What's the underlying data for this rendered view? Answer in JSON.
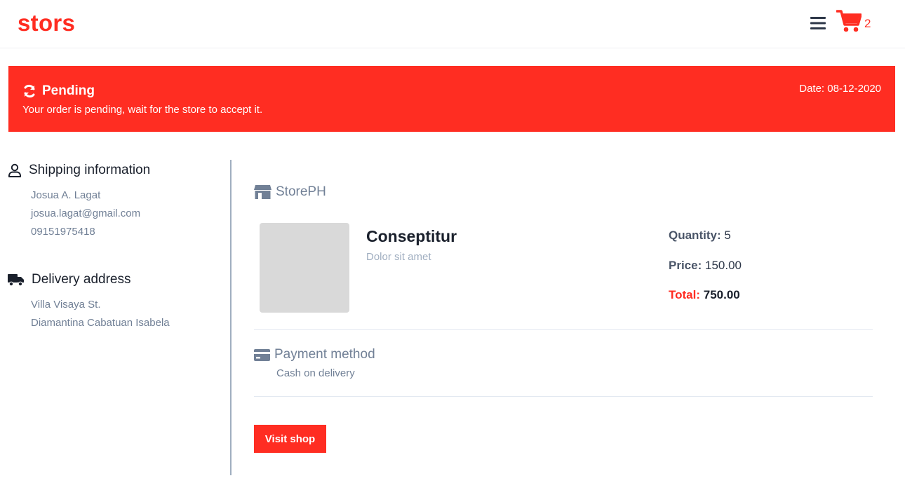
{
  "header": {
    "brand": "stors",
    "cart_count": "2",
    "accent_color": "#ff2d22",
    "icons": [
      "menu-icon",
      "cart-icon"
    ]
  },
  "banner": {
    "status": "Pending",
    "message": "Your order is pending, wait for the store to accept it.",
    "date": "Date: 08-12-2020",
    "icon": "refresh-icon"
  },
  "shipping": {
    "title": "Shipping information",
    "icon": "user-icon",
    "name": "Josua A. Lagat",
    "email": "josua.lagat@gmail.com",
    "phone": "09151975418"
  },
  "delivery": {
    "title": "Delivery address",
    "icon": "truck-icon",
    "line1": "Villa Visaya St.",
    "line2": "Diamantina Cabatuan Isabela"
  },
  "order": {
    "store_name": "StorePH",
    "store_icon": "store-icon",
    "product_name": "Conseptitur",
    "product_desc": "Dolor sit amet",
    "quantity_label": "Quantity:",
    "quantity": "5",
    "price_label": "Price:",
    "price": "150.00",
    "total_label": "Total:",
    "total": "750.00"
  },
  "payment": {
    "title": "Payment method",
    "icon": "credit-card-icon",
    "value": "Cash on delivery"
  },
  "actions": {
    "visit_shop": "Visit shop"
  }
}
